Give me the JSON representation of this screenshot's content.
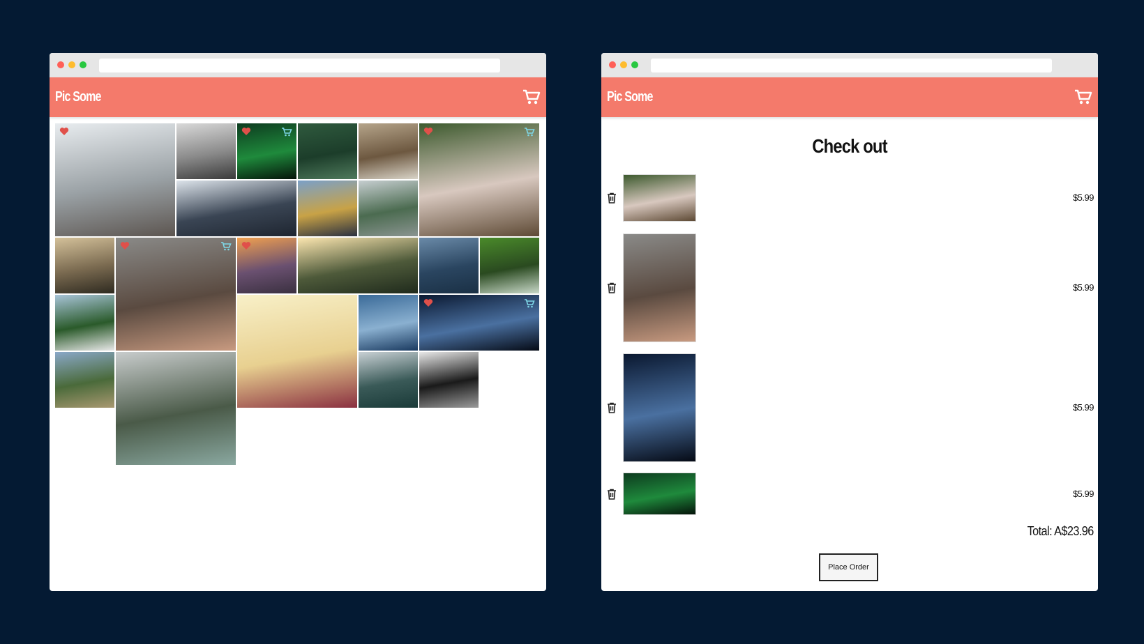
{
  "app": {
    "logo": "Pic Some"
  },
  "gallery": {
    "photos": [
      {
        "id": "bear",
        "fav": true,
        "cart": false,
        "colors": [
          "#e8ecef",
          "#9aa1a5",
          "#5c5550"
        ]
      },
      {
        "id": "fog-forest",
        "fav": false,
        "cart": false,
        "colors": [
          "#d9d9d9",
          "#8a8a8a",
          "#3a3a3a"
        ]
      },
      {
        "id": "aurora",
        "fav": true,
        "cart": true,
        "colors": [
          "#0d3b1f",
          "#1f8a3c",
          "#05140a"
        ]
      },
      {
        "id": "pines",
        "fav": false,
        "cart": false,
        "colors": [
          "#2f5a3e",
          "#1c3d2a",
          "#4f7a5c"
        ]
      },
      {
        "id": "eagle",
        "fav": false,
        "cart": false,
        "colors": [
          "#b5a48a",
          "#6d5840",
          "#d9d4c8"
        ]
      },
      {
        "id": "pug",
        "fav": true,
        "cart": true,
        "colors": [
          "#3d5a2e",
          "#d8c8bf",
          "#5e4a35"
        ]
      },
      {
        "id": "skyscraper",
        "fav": false,
        "cart": false,
        "colors": [
          "#dce3ea",
          "#3a4554",
          "#1e2530"
        ]
      },
      {
        "id": "field-feet",
        "fav": false,
        "cart": false,
        "colors": [
          "#7aa0c8",
          "#c8a246",
          "#2a3040"
        ]
      },
      {
        "id": "city-park",
        "fav": false,
        "cart": false,
        "colors": [
          "#c6ced0",
          "#4b6b50",
          "#8a9490"
        ]
      },
      {
        "id": "dead-trees",
        "fav": false,
        "cart": false,
        "colors": [
          "#d4c19a",
          "#7a6a50",
          "#2e2a20"
        ]
      },
      {
        "id": "woman",
        "fav": true,
        "cart": true,
        "colors": [
          "#8a8a88",
          "#5a4a40",
          "#c89a80"
        ]
      },
      {
        "id": "tracks-sunset",
        "fav": true,
        "cart": false,
        "colors": [
          "#f0a050",
          "#6a5070",
          "#3a3040"
        ]
      },
      {
        "id": "mountain-sun",
        "fav": false,
        "cart": false,
        "colors": [
          "#fce6b0",
          "#4e5a3a",
          "#1f2a1c"
        ]
      },
      {
        "id": "sea",
        "fav": false,
        "cart": false,
        "colors": [
          "#6a8aa8",
          "#2a4560",
          "#1a3045"
        ]
      },
      {
        "id": "waterfall",
        "fav": false,
        "cart": false,
        "colors": [
          "#4a8a2a",
          "#2a4a20",
          "#c8d8c8"
        ]
      },
      {
        "id": "castle",
        "fav": false,
        "cart": false,
        "colors": [
          "#a8c4d8",
          "#2a5a2a",
          "#e8e8e8"
        ]
      },
      {
        "id": "dreamcatcher",
        "fav": false,
        "cart": false,
        "colors": [
          "#f8f0c8",
          "#e8d090",
          "#8a3040"
        ]
      },
      {
        "id": "wave",
        "fav": false,
        "cart": false,
        "colors": [
          "#3a6a98",
          "#8ab0d0",
          "#1a3a60"
        ]
      },
      {
        "id": "star-trails",
        "fav": true,
        "cart": true,
        "colors": [
          "#0a1830",
          "#4a70a0",
          "#050a15"
        ]
      },
      {
        "id": "yosemite",
        "fav": false,
        "cart": false,
        "colors": [
          "#8aa8c8",
          "#4a6a3a",
          "#a89870"
        ]
      },
      {
        "id": "river-mist",
        "fav": false,
        "cart": false,
        "colors": [
          "#c8cccc",
          "#4a5a48",
          "#8aa8a0"
        ]
      },
      {
        "id": "mist-mountain",
        "fav": false,
        "cart": false,
        "colors": [
          "#c8d0d4",
          "#3a5a58",
          "#1a3a38"
        ]
      },
      {
        "id": "sea-stack",
        "fav": false,
        "cart": false,
        "colors": [
          "#e8e8e8",
          "#1a1a1a",
          "#9a9a9a"
        ]
      }
    ]
  },
  "checkout": {
    "title": "Check out",
    "items": [
      {
        "id": "pug",
        "price": "$5.99",
        "colors": [
          "#3d5a2e",
          "#d8c8bf",
          "#5e4a35"
        ]
      },
      {
        "id": "woman",
        "price": "$5.99",
        "colors": [
          "#8a8a88",
          "#5a4a40",
          "#c89a80"
        ]
      },
      {
        "id": "star-trails",
        "price": "$5.99",
        "colors": [
          "#0a1830",
          "#4a70a0",
          "#050a15"
        ]
      },
      {
        "id": "aurora",
        "price": "$5.99",
        "colors": [
          "#0d3b1f",
          "#1f8a3c",
          "#05140a"
        ]
      }
    ],
    "total": "Total: A$23.96",
    "place_order_label": "Place Order"
  },
  "icon_colors": {
    "heart": "#e0504a",
    "cart_mini": "#7fd8e8",
    "cart": "#ffffff",
    "trash": "#222222"
  }
}
